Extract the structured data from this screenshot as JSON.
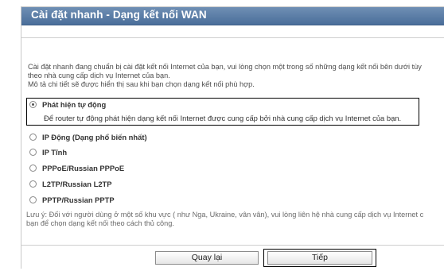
{
  "header": {
    "title": "Cài đặt nhanh - Dạng kết nối WAN"
  },
  "description": {
    "lines": [
      "Cài đặt nhanh đang chuẩn bị cài đặt kết nối Internet của bạn, vui lòng chọn một trong số những dạng kết nối bên dưới tùy",
      "theo nhà cung cấp dịch vụ Internet của bạn.",
      "Mô tả chi tiết sẽ được hiển thị sau khi bạn chọn dạng kết nối phù hợp."
    ]
  },
  "options": [
    {
      "label": "Phát hiện tự động",
      "selected": true
    },
    {
      "label": "IP Động (Dạng phổ biến nhất)",
      "selected": false
    },
    {
      "label": "IP Tĩnh",
      "selected": false
    },
    {
      "label": "PPPoE/Russian PPPoE",
      "selected": false
    },
    {
      "label": "L2TP/Russian L2TP",
      "selected": false
    },
    {
      "label": "PPTP/Russian PPTP",
      "selected": false
    }
  ],
  "selected_description": "Để router tự động phát hiện dạng kết nối Internet được cung cấp bởi nhà cung cấp dịch vụ Internet của bạn.",
  "note": {
    "lines": [
      "Lưu ý: Đối với người dùng ở một số khu vực ( như Nga, Ukraine, vân vân), vui lòng liên hệ nhà cung cấp dịch vụ Internet c",
      "bạn để chọn dạng kết nối theo cách thủ công."
    ]
  },
  "buttons": {
    "back": "Quay lại",
    "next": "Tiếp"
  }
}
